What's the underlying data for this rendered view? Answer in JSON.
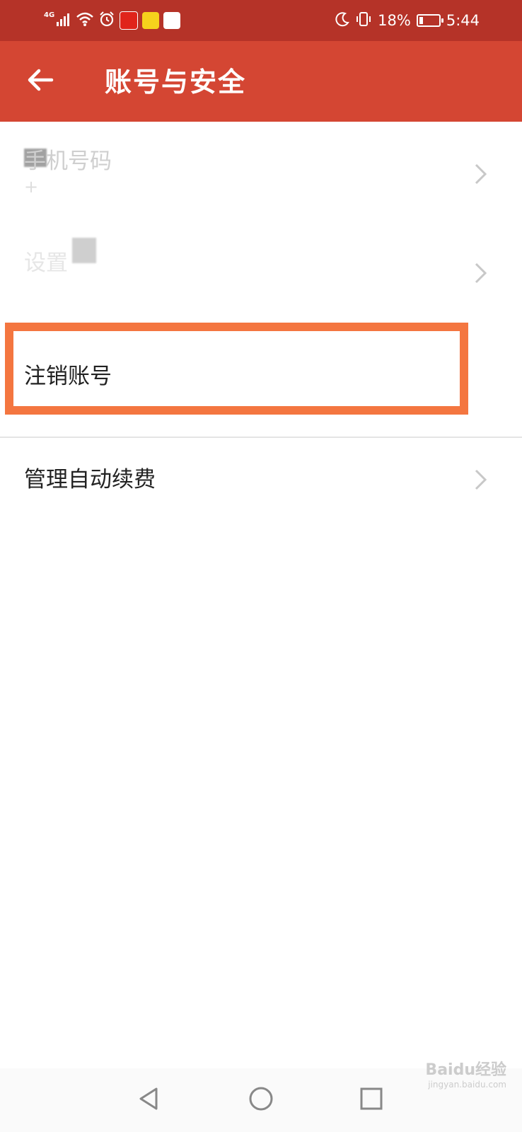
{
  "status_bar": {
    "network": "4G",
    "battery_text": "18%",
    "battery_level": 0.18,
    "time": "5:44",
    "icons": [
      "signal-icon",
      "wifi-icon",
      "alarm-icon",
      "app-badge-icon",
      "app-badge-icon",
      "app-badge-icon",
      "moon-icon",
      "vibrate-icon",
      "battery-icon"
    ]
  },
  "app_bar": {
    "title": "账号与安全",
    "back_icon": "back-arrow-icon"
  },
  "list": {
    "items": [
      {
        "title": "手机号码",
        "subtitle": "+",
        "chevron": true
      },
      {
        "title": "设置",
        "subtitle": "",
        "chevron": true
      },
      {
        "title": "注销账号",
        "subtitle": "",
        "chevron": false
      },
      {
        "title": "管理自动续费",
        "subtitle": "",
        "chevron": true
      }
    ]
  },
  "nav_bar": {
    "icons": [
      "nav-back-icon",
      "nav-home-icon",
      "nav-recents-icon"
    ]
  },
  "watermark": {
    "text": "Baidu经验",
    "sub": "jingyan.baidu.com"
  },
  "colors": {
    "status_bar": "#b53328",
    "app_bar": "#d44633",
    "highlight": "#f47640"
  }
}
